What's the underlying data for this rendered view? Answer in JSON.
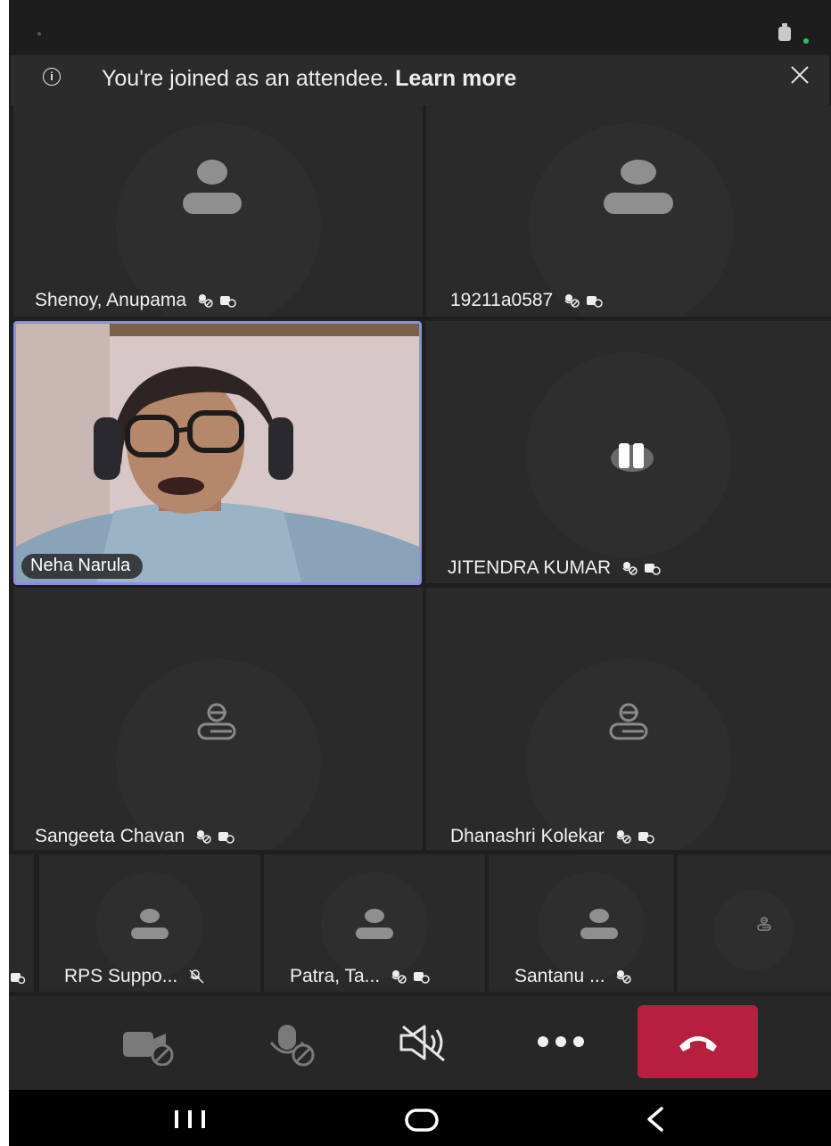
{
  "banner": {
    "message": "You're joined as an attendee.",
    "link": "Learn more"
  },
  "participants": {
    "p1": "Shenoy, Anupama",
    "p2": "19211a0587",
    "p3": "Neha Narula",
    "p4": "JITENDRA  KUMAR",
    "p5": "Sangeeta Chavan",
    "p6": "Dhanashri Kolekar"
  },
  "strip": {
    "s1": "RPS Suppo...",
    "s2": "Patra, Ta...",
    "s3": "Santanu ..."
  },
  "icons": {
    "info": "info-icon",
    "close": "close-icon",
    "mic_off": "mic-off-icon",
    "camera_off": "camera-off-icon",
    "speaker_off": "speaker-off-icon",
    "more": "more-options-icon",
    "hangup": "hang-up-icon",
    "pause": "pause-icon"
  },
  "colors": {
    "hangup": "#b5203f",
    "active_border": "#8b8ee6",
    "tile_bg": "#2a2a2a"
  }
}
